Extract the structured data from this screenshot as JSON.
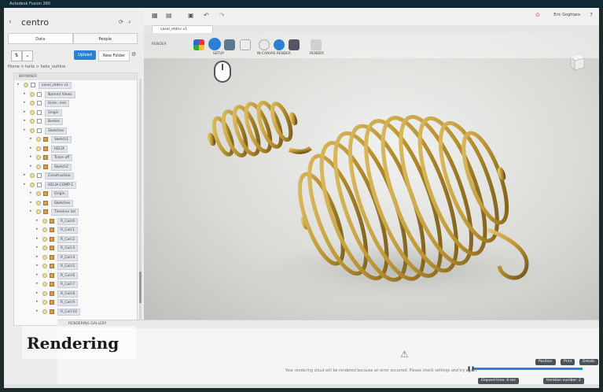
{
  "window": {
    "title": "Autodesk Fusion 360"
  },
  "project": {
    "name": "centro"
  },
  "panel": {
    "tabs": [
      {
        "label": "Data"
      },
      {
        "label": "People"
      }
    ],
    "upload_label": "Upload",
    "new_folder_label": "New Folder",
    "breadcrumb": "Home  >  helix  >  helix_outline"
  },
  "browser": {
    "header": "BROWSER",
    "rows": [
      {
        "label": "vasel_etdnv v1",
        "indent": 0
      },
      {
        "label": "Named Views",
        "indent": 1
      },
      {
        "label": "Units: mm",
        "indent": 1
      },
      {
        "label": "Origin",
        "indent": 1
      },
      {
        "label": "Bodies",
        "indent": 1
      },
      {
        "label": "Sketches",
        "indent": 1
      },
      {
        "label": "Sketch1",
        "indent": 2
      },
      {
        "label": "HELIX",
        "indent": 2
      },
      {
        "label": "Trace off",
        "indent": 2
      },
      {
        "label": "Sketch2",
        "indent": 2
      },
      {
        "label": "Construction",
        "indent": 1
      },
      {
        "label": "HELIX-COMP:1",
        "indent": 1
      },
      {
        "label": "Origin",
        "indent": 2
      },
      {
        "label": "Sketches",
        "indent": 2
      },
      {
        "label": "Timeline list",
        "indent": 2
      },
      {
        "label": "R_Coil:0",
        "indent": 3
      },
      {
        "label": "R_Coil:1",
        "indent": 3
      },
      {
        "label": "R_Coil:2",
        "indent": 3
      },
      {
        "label": "R_Coil:3",
        "indent": 3
      },
      {
        "label": "R_Coil:4",
        "indent": 3
      },
      {
        "label": "R_Coil:5",
        "indent": 3
      },
      {
        "label": "R_Coil:6",
        "indent": 3
      },
      {
        "label": "R_Coil:7",
        "indent": 3
      },
      {
        "label": "R_Coil:8",
        "indent": 3
      },
      {
        "label": "R_Coil:9",
        "indent": 3
      },
      {
        "label": "R_Coil:10",
        "indent": 3
      }
    ]
  },
  "toolbar": {
    "user": "Eric Goghiara",
    "doc_tab": "vasel_etdnv v1",
    "workspace": "RENDER",
    "groups": [
      {
        "label": "SETUP"
      },
      {
        "label": "IN-CANVAS RENDER"
      },
      {
        "label": "RENDER"
      }
    ]
  },
  "gallery": {
    "header": "RENDERING GALLERY",
    "message": "Your rendering cloud will be rendered because an error occurred. Please check settings and try again.",
    "buttons": [
      "Position",
      "Print",
      "Details"
    ],
    "status_1": "Elapsed time: 8 sec",
    "status_2": "Iteration number: 2"
  },
  "overlay": {
    "title": "Rendering"
  },
  "colors": {
    "accent": "#2d7fd3",
    "gold": "#b8912f",
    "titlebar": "#0f2a35"
  }
}
